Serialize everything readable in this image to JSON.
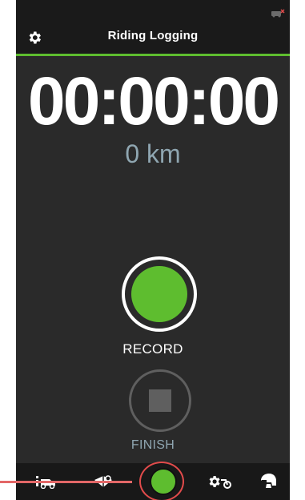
{
  "header": {
    "title": "Riding Logging",
    "settings_icon": "gear-icon",
    "status_icon": "device-status-icon"
  },
  "main": {
    "timer": "00:00:00",
    "distance": "0 km",
    "record_label": "RECORD",
    "finish_label": "FINISH"
  },
  "bottom_nav": {
    "items": [
      {
        "icon": "ride-info-icon"
      },
      {
        "icon": "route-map-icon"
      },
      {
        "icon": "record-dot-icon"
      },
      {
        "icon": "bike-settings-icon"
      },
      {
        "icon": "helmet-icon"
      }
    ]
  },
  "colors": {
    "accent": "#5ebd2f",
    "background": "#2a2a2a",
    "header": "#1a1a1a",
    "muted_text": "#8fa6b1",
    "annotation": "#e36767"
  }
}
